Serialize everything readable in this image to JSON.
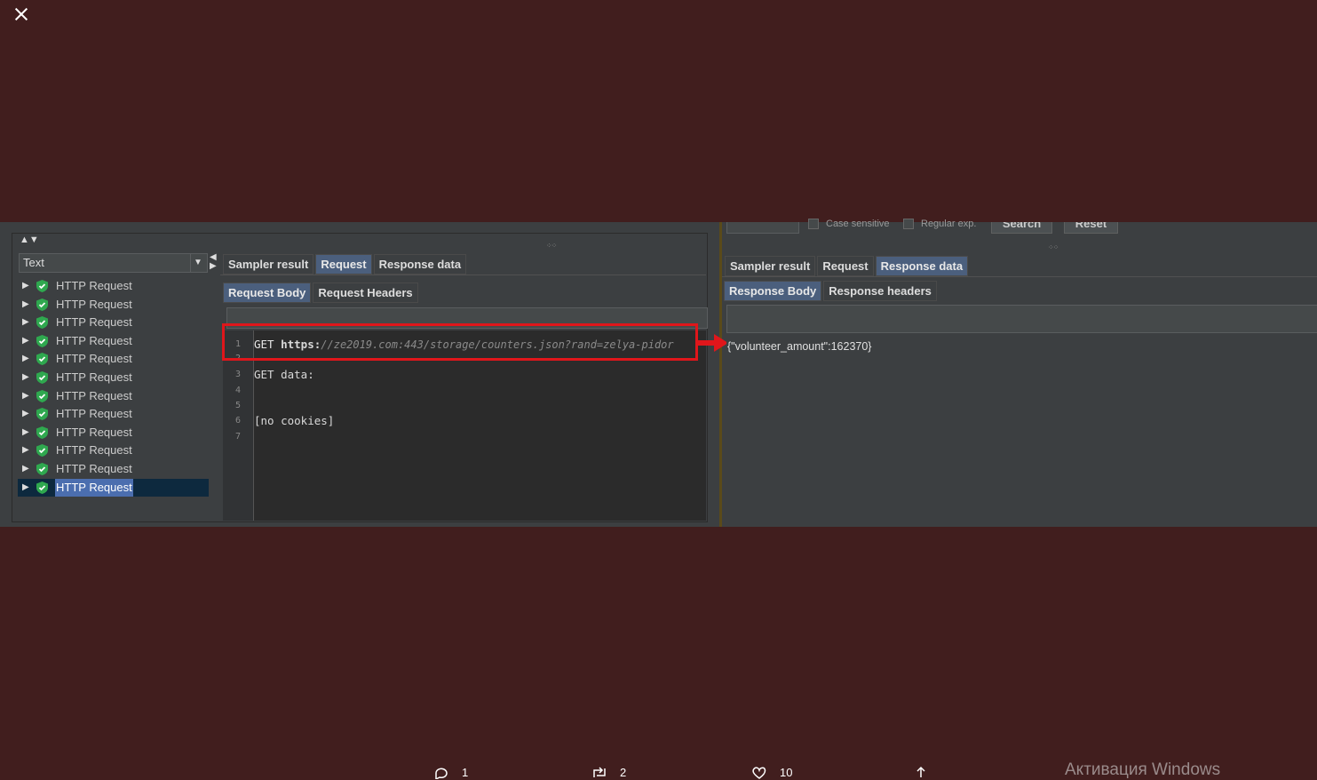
{
  "close_icon": "close-icon",
  "left_panel": {
    "sort_arrows": "▲▼",
    "renderer_select": {
      "value": "Text"
    },
    "tree_items": [
      {
        "label": "HTTP Request"
      },
      {
        "label": "HTTP Request"
      },
      {
        "label": "HTTP Request"
      },
      {
        "label": "HTTP Request"
      },
      {
        "label": "HTTP Request"
      },
      {
        "label": "HTTP Request"
      },
      {
        "label": "HTTP Request"
      },
      {
        "label": "HTTP Request"
      },
      {
        "label": "HTTP Request"
      },
      {
        "label": "HTTP Request"
      },
      {
        "label": "HTTP Request"
      },
      {
        "label": "HTTP Request",
        "selected": true
      }
    ],
    "tabs": [
      "Sampler result",
      "Request",
      "Response data"
    ],
    "active_tab": "Request",
    "subtabs": [
      "Request Body",
      "Request Headers"
    ],
    "active_subtab": "Request Body",
    "editor": {
      "line_numbers": [
        "1",
        "2",
        "3",
        "4",
        "5",
        "6",
        "7"
      ],
      "line1_method": "GET ",
      "line1_scheme": "https:",
      "line1_url": "//ze2019.com:443/storage/counters.json?rand=zelya-pidor",
      "line3": "GET data:",
      "line6": "[no cookies]"
    }
  },
  "right_panel": {
    "case_sensitive_label": "Case sensitive",
    "regular_exp_label": "Regular exp.",
    "search_button": "Search",
    "reset_button": "Reset",
    "tabs": [
      "Sampler result",
      "Request",
      "Response data"
    ],
    "active_tab": "Response data",
    "subtabs": [
      "Response Body",
      "Response headers"
    ],
    "active_subtab": "Response Body",
    "response_body": "{\"volunteer_amount\":162370}"
  },
  "social_bar": {
    "replies": "1",
    "retweets": "2",
    "likes": "10"
  },
  "watermark": "Активация Windows",
  "colors": {
    "background": "#411e1e",
    "highlight_red": "#e0161b",
    "selection_blue": "#4b6eaf"
  }
}
